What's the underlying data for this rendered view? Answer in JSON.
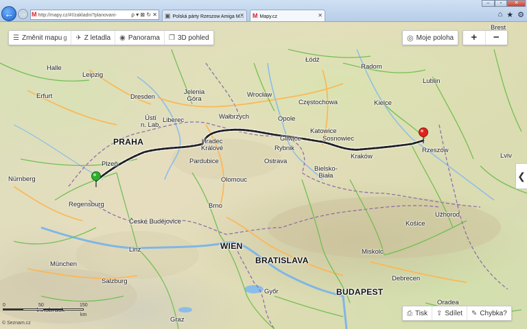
{
  "browser": {
    "address": "http://mapy.cz/#!/zakladni?planovani-",
    "address_tools": "ρ ▾ ⊠ ↻ ✕",
    "tabs": [
      {
        "label": "Polská párty Rzeszow Amiga M...",
        "close": "✕"
      },
      {
        "label": "Mapy.cz",
        "close": "✕"
      }
    ],
    "window_controls": [
      "–",
      "▫",
      "✕"
    ],
    "toolbar_icons": [
      "home-icon",
      "star-icon",
      "gear-icon"
    ]
  },
  "toolbar": {
    "change_map": "Změnit mapu",
    "from_plane": "Z letadla",
    "panorama": "Panorama",
    "view_3d": "3D pohled",
    "my_location": "Moje poloha",
    "zoom_in": "+",
    "zoom_out": "−"
  },
  "bottom_toolbar": {
    "print": "Tisk",
    "share": "Sdílet",
    "error": "Chybka?"
  },
  "scale": {
    "zero": "0",
    "mid": "50",
    "max": "150",
    "unit_km": "km",
    "unit_mi": "mi"
  },
  "copyright": "© Seznam.cz",
  "map_labels": {
    "praha": "PRAHA",
    "wien": "WIEN",
    "bratislava": "BRATISLAVA",
    "budapest": "BUDAPEST",
    "halle": "Halle",
    "leipzig": "Leipzig",
    "erfurt": "Erfurt",
    "dresden": "Dresden",
    "jelenia_gora": "Jelenia\nGóra",
    "wroclaw": "Wrocław",
    "lodz": "Łódź",
    "radom": "Radom",
    "brest": "Brest",
    "lublin": "Lublin",
    "czestochowa": "Częstochowa",
    "kielce": "Kielce",
    "walbrzych": "Wałbrzych",
    "opole": "Opole",
    "usti": "Ústí\nn. Lab.",
    "liberec": "Liberec",
    "katowice": "Katowice",
    "gliwice": "Gliwice",
    "sosnowiec": "Sosnowiec",
    "rybnik": "Rybnik",
    "hradec": "Hradec\nKrálové",
    "rzeszow": "Rzeszów",
    "krakow": "Kraków",
    "ostrava": "Ostrava",
    "bielsko": "Bielsko-\nBiała",
    "plzen": "Plzeň",
    "pardubice": "Pardubice",
    "lviv": "Lviv",
    "nurnberg": "Nürnberg",
    "olomouc": "Olomouc",
    "regensburg": "Regensburg",
    "brno": "Brno",
    "ceske": "České Budějovice",
    "kosice": "Košice",
    "uzhorod": "Užhorod",
    "linz": "Linz",
    "miskolc": "Miskolc",
    "munchen": "München",
    "salzburg": "Salzburg",
    "debrecen": "Debrecen",
    "gyor": "Győr",
    "innsbruck": "Innsbruck",
    "graz": "Graz",
    "oradea": "Oradea"
  }
}
